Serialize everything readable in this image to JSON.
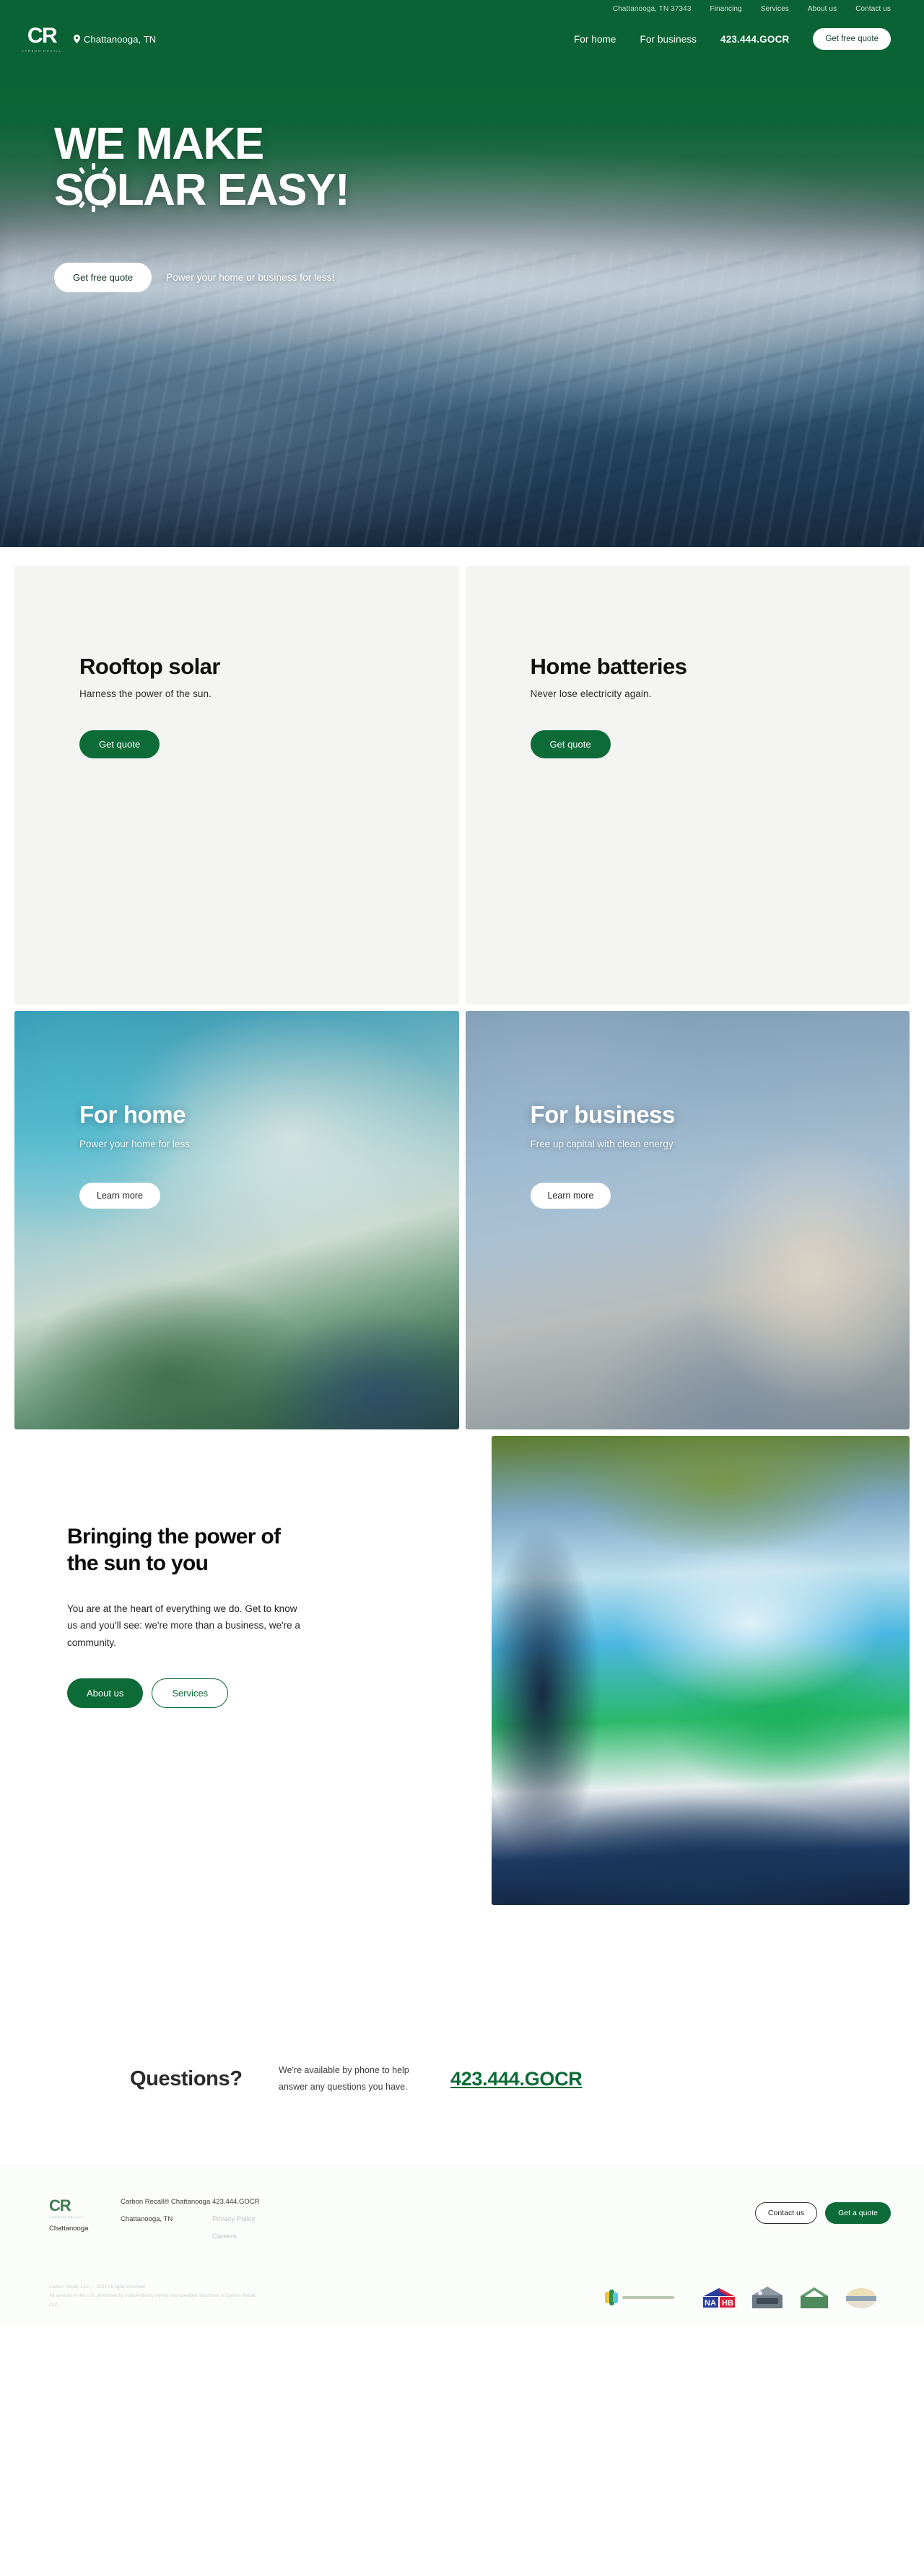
{
  "topbar": {
    "address": "Chattanooga, TN 37343",
    "links": [
      "Financing",
      "Services",
      "About us",
      "Contact us"
    ]
  },
  "navbar": {
    "logo_mark": "CR",
    "logo_sub": "Carbon Recall",
    "location": "Chattanooga, TN",
    "location_icon": "map-pin-icon",
    "links": [
      "For home",
      "For business"
    ],
    "phone": "423.444.GOCR",
    "cta": "Get free quote"
  },
  "hero": {
    "line1": "WE MAKE",
    "line2": "SOLAR EASY!",
    "sun_icon": "sunburst-icon",
    "cta": "Get free quote",
    "tagline": "Power your home or business for less!"
  },
  "services": [
    {
      "title": "Rooftop solar",
      "subtitle": "Harness the power of the sun.",
      "cta": "Get quote"
    },
    {
      "title": "Home batteries",
      "subtitle": "Never lose electricity again.",
      "cta": "Get quote"
    }
  ],
  "segments": [
    {
      "title": "For home",
      "subtitle": "Power your home for less",
      "cta": "Learn more"
    },
    {
      "title": "For business",
      "subtitle": "Free up capital with clean energy",
      "cta": "Learn more"
    }
  ],
  "about": {
    "heading": "Bringing the power of the sun to you",
    "body": "You are at the heart of everything we do. Get to know us and you'll see: we're more than a business, we're a community.",
    "primary_cta": "About us",
    "secondary_cta": "Services"
  },
  "questions": {
    "title": "Questions?",
    "text": "We're available by phone to help answer any questions you have.",
    "phone": "423.444.GOCR"
  },
  "footer": {
    "logo_mark": "CR",
    "logo_sub": "Carbon Recall",
    "logo_city": "Chattanooga",
    "company": "Carbon Recall® Chattanooga",
    "city": "Chattanooga, TN",
    "phone": "423.444.GOCR",
    "links": [
      "Privacy Policy",
      "Careers"
    ],
    "contact_cta": "Contact us",
    "quote_cta": "Get a quote",
    "legal_line1": "Carbon Recall, LLC — 2024 All rights reserved",
    "legal_line2": "All services in the U.S. performed by independently owned and operated franchises of Carbon Recall, LLC.",
    "badges": [
      "solar-partner-badge",
      "nahb-badge",
      "bbb-badge",
      "green-home-badge",
      "energy-badge"
    ]
  },
  "colors": {
    "brand_green": "#0c6b37",
    "header_green": "#0a6334",
    "card_bg": "#f4f4f2"
  }
}
